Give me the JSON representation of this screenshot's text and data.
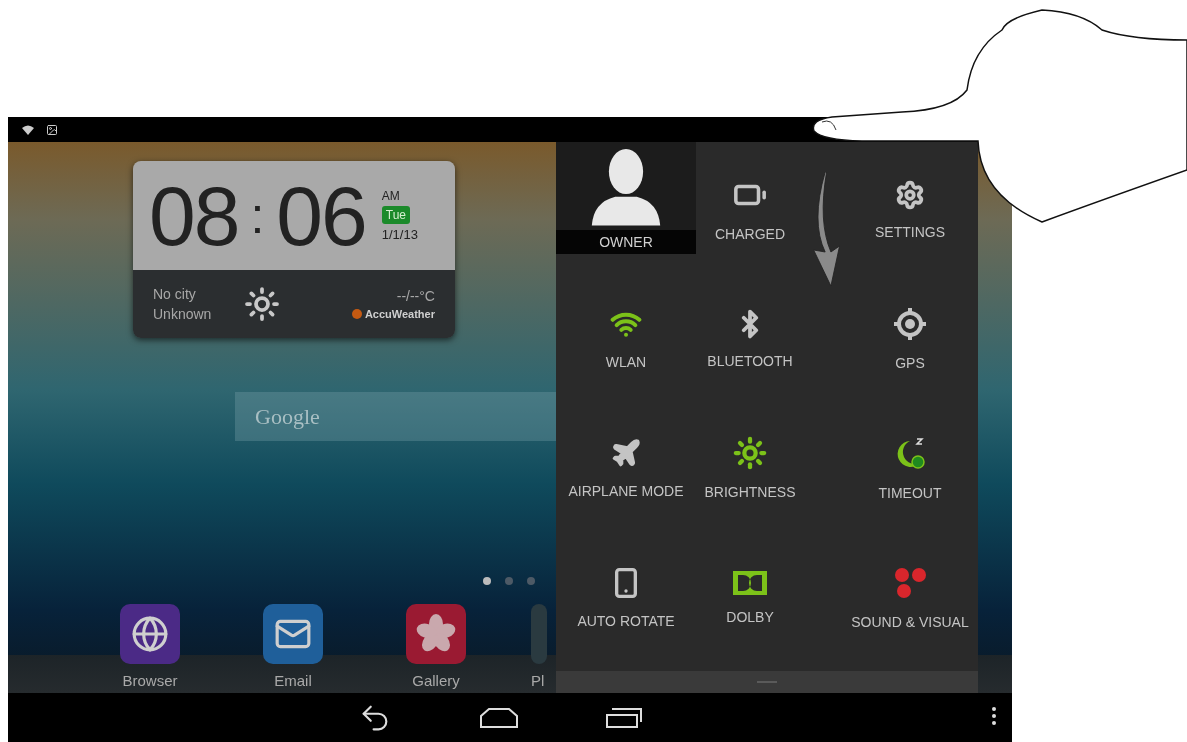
{
  "clock_widget": {
    "hours": "08",
    "separator": ":",
    "minutes": "06",
    "meridiem": "AM",
    "day": "Tue",
    "date": "1/1/13"
  },
  "weather": {
    "city": "No city",
    "condition": "Unknown",
    "temperature": "--/--°C",
    "provider": "AccuWeather"
  },
  "search": {
    "placeholder": "Google"
  },
  "page_indicator": [
    {
      "selected": true
    },
    {
      "selected": false
    },
    {
      "selected": false
    }
  ],
  "dock": [
    {
      "label": "Browser",
      "kind": "browser"
    },
    {
      "label": "Email",
      "kind": "email"
    },
    {
      "label": "Gallery",
      "kind": "gallery"
    },
    {
      "label": "Pl",
      "kind": "cut"
    }
  ],
  "quick_settings": [
    {
      "label": "OWNER",
      "kind": "user"
    },
    {
      "label": "CHARGED",
      "kind": "battery",
      "on": false
    },
    {
      "label": "SETTINGS",
      "kind": "settings",
      "on": false
    },
    {
      "label": "WLAN",
      "kind": "wifi",
      "on": true
    },
    {
      "label": "BLUETOOTH",
      "kind": "bluetooth",
      "on": false
    },
    {
      "label": "GPS",
      "kind": "gps",
      "on": false
    },
    {
      "label": "AIRPLANE MODE",
      "kind": "airplane",
      "on": false
    },
    {
      "label": "BRIGHTNESS",
      "kind": "brightness",
      "on": true
    },
    {
      "label": "TIMEOUT",
      "kind": "timeout",
      "on": true
    },
    {
      "label": "AUTO ROTATE",
      "kind": "rotate",
      "on": false
    },
    {
      "label": "DOLBY",
      "kind": "dolby",
      "on": true
    },
    {
      "label": "SOUND & VISUAL",
      "kind": "sound",
      "on": false
    }
  ]
}
